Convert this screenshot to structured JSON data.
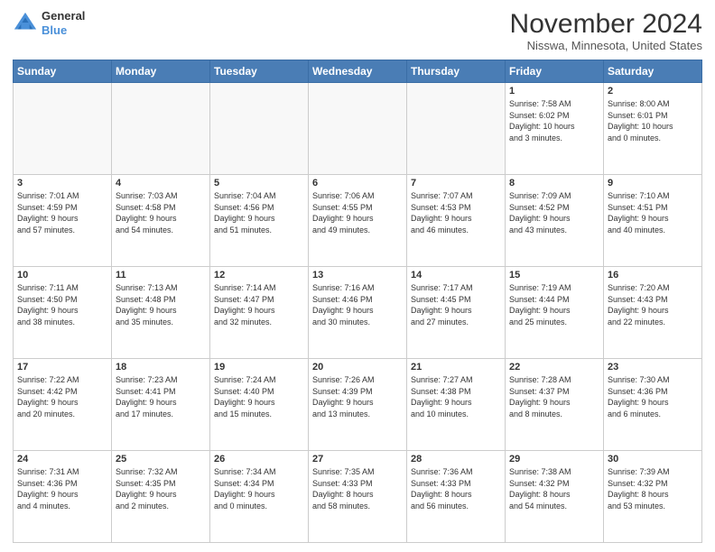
{
  "logo": {
    "line1": "General",
    "line2": "Blue"
  },
  "title": "November 2024",
  "location": "Nisswa, Minnesota, United States",
  "weekdays": [
    "Sunday",
    "Monday",
    "Tuesday",
    "Wednesday",
    "Thursday",
    "Friday",
    "Saturday"
  ],
  "weeks": [
    [
      {
        "day": "",
        "info": ""
      },
      {
        "day": "",
        "info": ""
      },
      {
        "day": "",
        "info": ""
      },
      {
        "day": "",
        "info": ""
      },
      {
        "day": "",
        "info": ""
      },
      {
        "day": "1",
        "info": "Sunrise: 7:58 AM\nSunset: 6:02 PM\nDaylight: 10 hours\nand 3 minutes."
      },
      {
        "day": "2",
        "info": "Sunrise: 8:00 AM\nSunset: 6:01 PM\nDaylight: 10 hours\nand 0 minutes."
      }
    ],
    [
      {
        "day": "3",
        "info": "Sunrise: 7:01 AM\nSunset: 4:59 PM\nDaylight: 9 hours\nand 57 minutes."
      },
      {
        "day": "4",
        "info": "Sunrise: 7:03 AM\nSunset: 4:58 PM\nDaylight: 9 hours\nand 54 minutes."
      },
      {
        "day": "5",
        "info": "Sunrise: 7:04 AM\nSunset: 4:56 PM\nDaylight: 9 hours\nand 51 minutes."
      },
      {
        "day": "6",
        "info": "Sunrise: 7:06 AM\nSunset: 4:55 PM\nDaylight: 9 hours\nand 49 minutes."
      },
      {
        "day": "7",
        "info": "Sunrise: 7:07 AM\nSunset: 4:53 PM\nDaylight: 9 hours\nand 46 minutes."
      },
      {
        "day": "8",
        "info": "Sunrise: 7:09 AM\nSunset: 4:52 PM\nDaylight: 9 hours\nand 43 minutes."
      },
      {
        "day": "9",
        "info": "Sunrise: 7:10 AM\nSunset: 4:51 PM\nDaylight: 9 hours\nand 40 minutes."
      }
    ],
    [
      {
        "day": "10",
        "info": "Sunrise: 7:11 AM\nSunset: 4:50 PM\nDaylight: 9 hours\nand 38 minutes."
      },
      {
        "day": "11",
        "info": "Sunrise: 7:13 AM\nSunset: 4:48 PM\nDaylight: 9 hours\nand 35 minutes."
      },
      {
        "day": "12",
        "info": "Sunrise: 7:14 AM\nSunset: 4:47 PM\nDaylight: 9 hours\nand 32 minutes."
      },
      {
        "day": "13",
        "info": "Sunrise: 7:16 AM\nSunset: 4:46 PM\nDaylight: 9 hours\nand 30 minutes."
      },
      {
        "day": "14",
        "info": "Sunrise: 7:17 AM\nSunset: 4:45 PM\nDaylight: 9 hours\nand 27 minutes."
      },
      {
        "day": "15",
        "info": "Sunrise: 7:19 AM\nSunset: 4:44 PM\nDaylight: 9 hours\nand 25 minutes."
      },
      {
        "day": "16",
        "info": "Sunrise: 7:20 AM\nSunset: 4:43 PM\nDaylight: 9 hours\nand 22 minutes."
      }
    ],
    [
      {
        "day": "17",
        "info": "Sunrise: 7:22 AM\nSunset: 4:42 PM\nDaylight: 9 hours\nand 20 minutes."
      },
      {
        "day": "18",
        "info": "Sunrise: 7:23 AM\nSunset: 4:41 PM\nDaylight: 9 hours\nand 17 minutes."
      },
      {
        "day": "19",
        "info": "Sunrise: 7:24 AM\nSunset: 4:40 PM\nDaylight: 9 hours\nand 15 minutes."
      },
      {
        "day": "20",
        "info": "Sunrise: 7:26 AM\nSunset: 4:39 PM\nDaylight: 9 hours\nand 13 minutes."
      },
      {
        "day": "21",
        "info": "Sunrise: 7:27 AM\nSunset: 4:38 PM\nDaylight: 9 hours\nand 10 minutes."
      },
      {
        "day": "22",
        "info": "Sunrise: 7:28 AM\nSunset: 4:37 PM\nDaylight: 9 hours\nand 8 minutes."
      },
      {
        "day": "23",
        "info": "Sunrise: 7:30 AM\nSunset: 4:36 PM\nDaylight: 9 hours\nand 6 minutes."
      }
    ],
    [
      {
        "day": "24",
        "info": "Sunrise: 7:31 AM\nSunset: 4:36 PM\nDaylight: 9 hours\nand 4 minutes."
      },
      {
        "day": "25",
        "info": "Sunrise: 7:32 AM\nSunset: 4:35 PM\nDaylight: 9 hours\nand 2 minutes."
      },
      {
        "day": "26",
        "info": "Sunrise: 7:34 AM\nSunset: 4:34 PM\nDaylight: 9 hours\nand 0 minutes."
      },
      {
        "day": "27",
        "info": "Sunrise: 7:35 AM\nSunset: 4:33 PM\nDaylight: 8 hours\nand 58 minutes."
      },
      {
        "day": "28",
        "info": "Sunrise: 7:36 AM\nSunset: 4:33 PM\nDaylight: 8 hours\nand 56 minutes."
      },
      {
        "day": "29",
        "info": "Sunrise: 7:38 AM\nSunset: 4:32 PM\nDaylight: 8 hours\nand 54 minutes."
      },
      {
        "day": "30",
        "info": "Sunrise: 7:39 AM\nSunset: 4:32 PM\nDaylight: 8 hours\nand 53 minutes."
      }
    ]
  ]
}
